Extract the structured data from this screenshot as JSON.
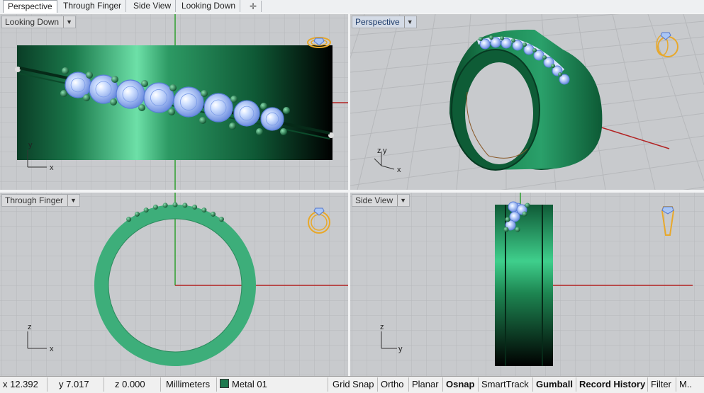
{
  "tabs": [
    {
      "label": "Perspective",
      "active": true
    },
    {
      "label": "Through Finger"
    },
    {
      "label": "Side View"
    },
    {
      "label": "Looking Down"
    }
  ],
  "tab_add_icon": "plus-icon",
  "viewports": {
    "looking_down": {
      "title": "Looking Down",
      "axis_x": "x",
      "axis_y": "y"
    },
    "perspective": {
      "title": "Perspective",
      "axis_x": "x",
      "axis_y": "y",
      "axis_z": "z"
    },
    "through_finger": {
      "title": "Through Finger",
      "axis_x": "x",
      "axis_z": "z"
    },
    "side_view": {
      "title": "Side View",
      "axis_y": "y",
      "axis_z": "z"
    }
  },
  "status": {
    "x": "x 12.392",
    "y": "y 7.017",
    "z": "z 0.000",
    "units": "Millimeters",
    "layer": "Metal 01",
    "layer_color": "#1e7a4f",
    "grid_snap": "Grid Snap",
    "ortho": "Ortho",
    "planar": "Planar",
    "osnap": "Osnap",
    "smarttrack": "SmartTrack",
    "gumball": "Gumball",
    "record_history": "Record History",
    "filter": "Filter",
    "more": "M.."
  },
  "colors": {
    "metal": "#1e7a4f",
    "gem": "#a9c6f5",
    "grid": "#b3b5b8",
    "axis_x": "#b22222",
    "axis_y": "#2fa02f"
  }
}
